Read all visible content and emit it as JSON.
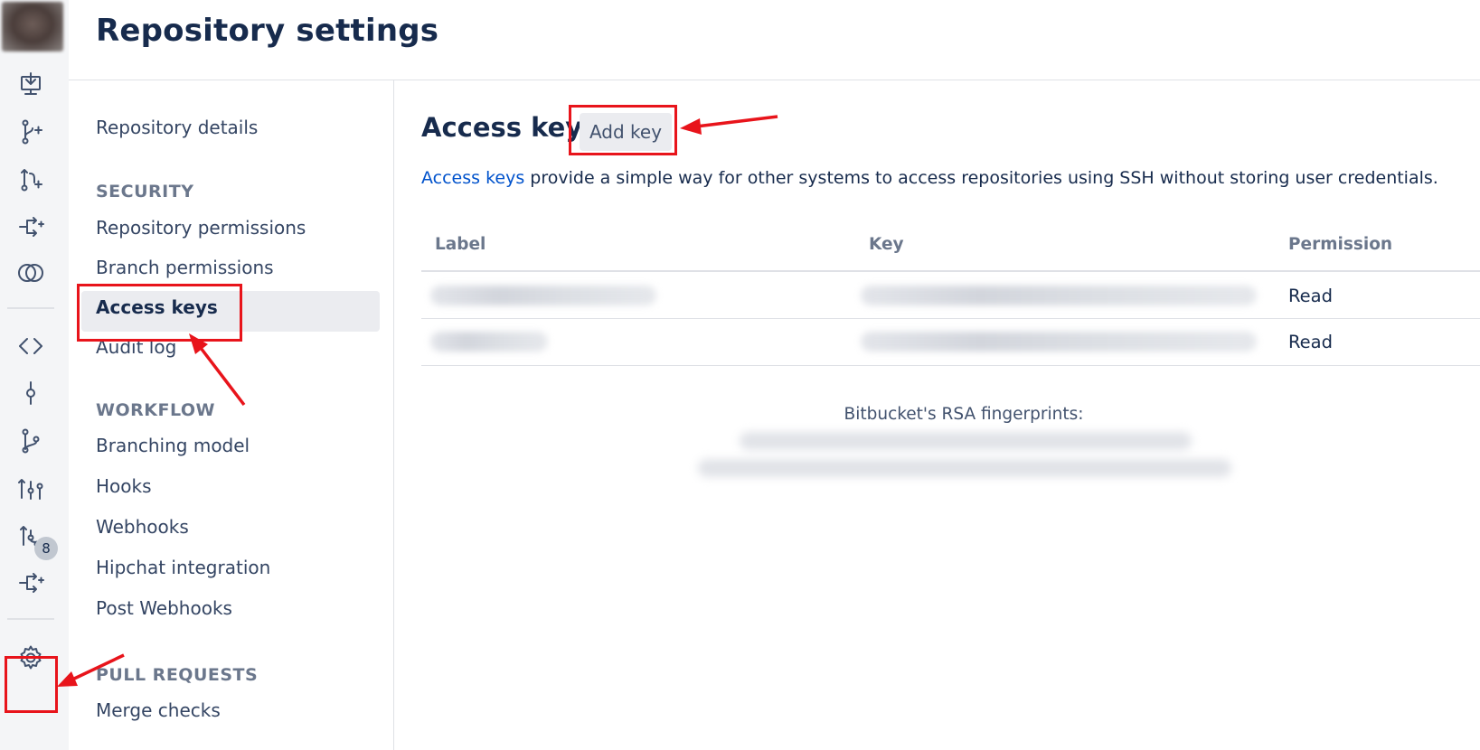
{
  "header": {
    "title": "Repository settings"
  },
  "rail": {
    "icons": [
      "download-icon",
      "create-branch-icon",
      "pull-request-icon",
      "pipeline-icon",
      "deployments-icon",
      "source-icon",
      "commits-icon",
      "branches-icon",
      "compare-icon",
      "pull-requests-icon",
      "pipelines-icon",
      "settings-icon"
    ],
    "pull_requests_badge": "8"
  },
  "settings_nav": {
    "general": [
      {
        "label": "Repository details"
      }
    ],
    "security": {
      "heading": "SECURITY",
      "items": [
        {
          "label": "Repository permissions"
        },
        {
          "label": "Branch permissions"
        },
        {
          "label": "Access keys",
          "active": true
        },
        {
          "label": "Audit log"
        }
      ]
    },
    "workflow": {
      "heading": "WORKFLOW",
      "items": [
        {
          "label": "Branching model"
        },
        {
          "label": "Hooks"
        },
        {
          "label": "Webhooks"
        },
        {
          "label": "Hipchat integration"
        },
        {
          "label": "Post Webhooks"
        }
      ]
    },
    "pull_requests": {
      "heading": "PULL REQUESTS",
      "items": [
        {
          "label": "Merge checks"
        }
      ]
    }
  },
  "main": {
    "title": "Access keys",
    "add_key_label": "Add key",
    "description_link": "Access keys",
    "description_text": " provide a simple way for other systems to access repositories using SSH without storing user credentials.",
    "table": {
      "columns": [
        "Label",
        "Key",
        "Permission"
      ],
      "rows": [
        {
          "label": "",
          "key": "",
          "permission": "Read"
        },
        {
          "label": "",
          "key": "",
          "permission": "Read"
        }
      ]
    },
    "fingerprints_title": "Bitbucket's RSA fingerprints:"
  },
  "colors": {
    "text": "#172b4d",
    "muted": "#6b778c",
    "link": "#0052cc",
    "active_bg": "#ebecf0",
    "annotation": "#e8141b"
  }
}
